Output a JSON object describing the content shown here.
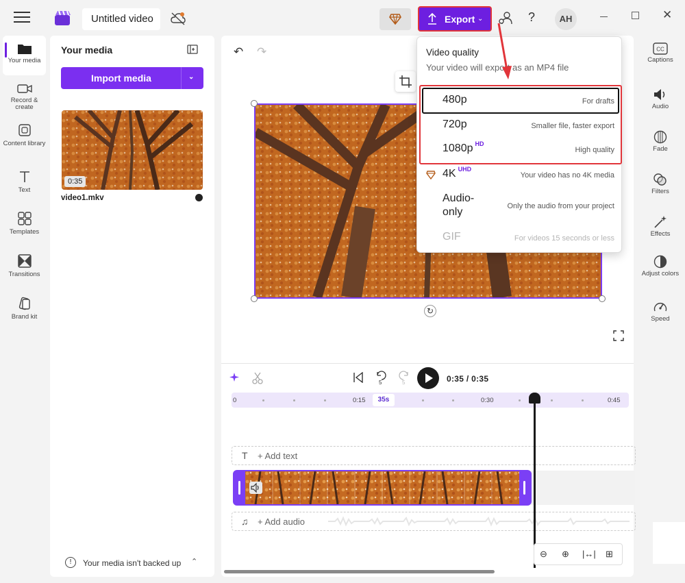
{
  "header": {
    "project_title": "Untitled video",
    "export_label": "Export",
    "avatar_initials": "AH",
    "help_label": "?"
  },
  "left_rail": {
    "items": [
      {
        "label": "Your media",
        "icon": "folder-icon"
      },
      {
        "label": "Record & create",
        "icon": "camera-icon"
      },
      {
        "label": "Content library",
        "icon": "library-icon"
      },
      {
        "label": "Text",
        "icon": "text-icon"
      },
      {
        "label": "Templates",
        "icon": "templates-icon"
      },
      {
        "label": "Transitions",
        "icon": "transitions-icon"
      },
      {
        "label": "Brand kit",
        "icon": "brand-kit-icon"
      }
    ]
  },
  "media_panel": {
    "title": "Your media",
    "import_label": "Import media",
    "file": {
      "name": "video1.mkv",
      "duration": "0:35"
    },
    "backup_notice": "Your media isn't backed up"
  },
  "export_menu": {
    "heading": "Video quality",
    "subheading": "Your video will export as an MP4 file",
    "options": [
      {
        "name": "480p",
        "badge": "",
        "desc": "For drafts",
        "selected": true
      },
      {
        "name": "720p",
        "badge": "",
        "desc": "Smaller file, faster export"
      },
      {
        "name": "1080p",
        "badge": "HD",
        "desc": "High quality"
      },
      {
        "name": "4K",
        "badge": "UHD",
        "desc": "Your video has no 4K media",
        "premium": true
      },
      {
        "name": "Audio-only",
        "badge": "",
        "desc": "Only the audio from your project"
      },
      {
        "name": "GIF",
        "badge": "",
        "desc": "For videos 15 seconds or less",
        "disabled": true
      }
    ]
  },
  "timeline": {
    "time_current": "0:35",
    "time_total": "0:35",
    "time_readout": "0:35 / 0:35",
    "playhead_marker": "35s",
    "ruler_labels": [
      "0",
      "0:15",
      "0:30",
      "0:45"
    ],
    "rewind_seconds": "5",
    "forward_seconds": "5",
    "add_text_label": "+ Add text",
    "add_audio_label": "+ Add audio"
  },
  "right_rail": {
    "items": [
      {
        "label": "Captions",
        "icon": "captions-icon"
      },
      {
        "label": "Audio",
        "icon": "speaker-icon"
      },
      {
        "label": "Fade",
        "icon": "fade-icon"
      },
      {
        "label": "Filters",
        "icon": "filters-icon"
      },
      {
        "label": "Effects",
        "icon": "effects-icon"
      },
      {
        "label": "Adjust colors",
        "icon": "adjust-colors-icon"
      },
      {
        "label": "Speed",
        "icon": "speed-icon"
      }
    ]
  },
  "colors": {
    "accent": "#6d1fe0",
    "highlight_red": "#e1353a",
    "autumn_orange": "#c8641e"
  }
}
